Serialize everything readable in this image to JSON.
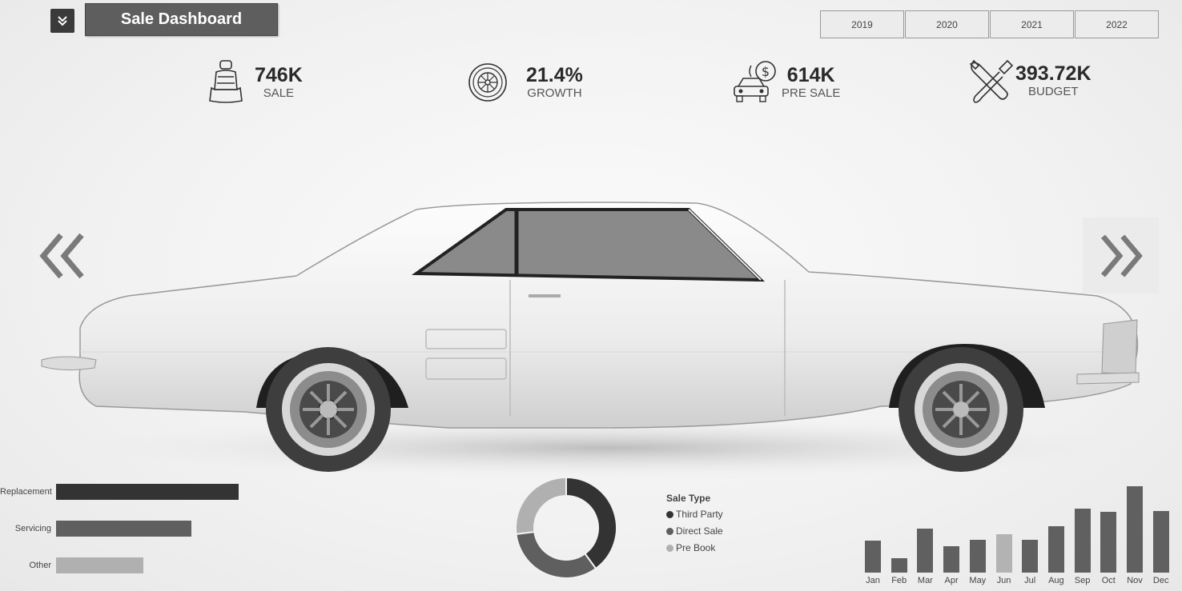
{
  "header": {
    "menu_icon": "double-chevron-down-icon",
    "title": "Sale Dashboard",
    "years": [
      "2019",
      "2020",
      "2021",
      "2022"
    ]
  },
  "kpis": [
    {
      "value": "746K",
      "label": "SALE",
      "icon": "car-seat-icon"
    },
    {
      "value": "21.4%",
      "label": "GROWTH",
      "icon": "tire-icon"
    },
    {
      "value": "614K",
      "label": "PRE SALE",
      "icon": "car-dollar-icon"
    },
    {
      "value": "393.72K",
      "label": "BUDGET",
      "icon": "wrench-screwdriver-icon"
    }
  ],
  "nav": {
    "prev_icon": "double-chevron-left-icon",
    "next_icon": "double-chevron-right-icon"
  },
  "service_bars": {
    "categories": [
      "Replacement",
      "Servicing",
      "Other"
    ],
    "values": [
      1.0,
      0.74,
      0.48
    ],
    "colors": [
      "#333333",
      "#5f5f5f",
      "#b0b0b0"
    ]
  },
  "donut": {
    "title": "Sale Type",
    "categories": [
      "Third Party",
      "Direct Sale",
      "Pre Book"
    ],
    "values": [
      0.4,
      0.33,
      0.27
    ],
    "colors": [
      "#333333",
      "#5f5f5f",
      "#b0b0b0"
    ]
  },
  "chart_data": {
    "type": "bar",
    "categories": [
      "Jan",
      "Feb",
      "Mar",
      "Apr",
      "May",
      "Jun",
      "Jul",
      "Aug",
      "Sep",
      "Oct",
      "Nov",
      "Dec"
    ],
    "values": [
      37,
      17,
      51,
      31,
      38,
      45,
      38,
      54,
      75,
      71,
      101,
      72
    ],
    "highlight_index": 5,
    "colors": {
      "bar": "#606060",
      "highlight": "#b3b3b3"
    }
  }
}
